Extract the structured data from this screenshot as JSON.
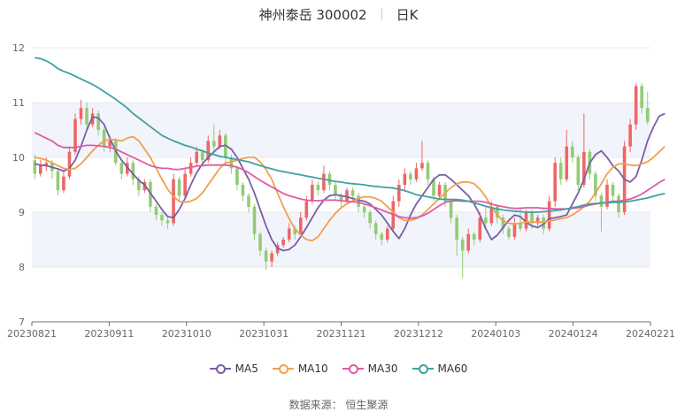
{
  "header": {
    "stock_title": "神州泰岳 300002",
    "period_label": "日K"
  },
  "source": {
    "text": "数据来源： 恒生聚源"
  },
  "colors": {
    "up": "#ee6666",
    "down": "#91cc75",
    "band": "#f2f4fb",
    "grid": "#e8e8e8"
  },
  "chart_data": {
    "type": "candlestick",
    "title": "神州泰岳 300002",
    "subtitle": "日K",
    "ylim": [
      7,
      12
    ],
    "y_ticks": [
      7,
      8,
      9,
      10,
      11,
      12
    ],
    "x_tick_labels": [
      "20230821",
      "20230911",
      "20231010",
      "20231031",
      "20231121",
      "20231212",
      "20240103",
      "20240124",
      "20240221"
    ],
    "legend": [
      "MA5",
      "MA10",
      "MA30",
      "MA60"
    ],
    "legend_position": "bottom",
    "series": [
      {
        "name": "MA5",
        "color": "#7b5ea7",
        "values": [
          9.88,
          9.86,
          9.85,
          9.82,
          9.79,
          9.75,
          9.8,
          9.95,
          10.2,
          10.5,
          10.74,
          10.72,
          10.6,
          10.35,
          10.12,
          9.95,
          9.82,
          9.7,
          9.58,
          9.5,
          9.35,
          9.2,
          9.05,
          8.92,
          8.9,
          9.05,
          9.25,
          9.5,
          9.72,
          9.88,
          10.0,
          10.1,
          10.2,
          10.22,
          10.15,
          10.0,
          9.8,
          9.6,
          9.35,
          9.05,
          8.75,
          8.5,
          8.34,
          8.3,
          8.32,
          8.4,
          8.55,
          8.72,
          8.9,
          9.08,
          9.22,
          9.3,
          9.32,
          9.3,
          9.28,
          9.25,
          9.22,
          9.2,
          9.15,
          9.05,
          8.95,
          8.8,
          8.65,
          8.52,
          8.7,
          8.95,
          9.15,
          9.3,
          9.45,
          9.6,
          9.68,
          9.68,
          9.6,
          9.5,
          9.4,
          9.3,
          9.15,
          8.95,
          8.7,
          8.5,
          8.58,
          8.72,
          8.85,
          8.95,
          8.92,
          8.82,
          8.75,
          8.72,
          8.78,
          8.88,
          8.9,
          8.92,
          8.95,
          9.15,
          9.35,
          9.6,
          9.9,
          10.05,
          10.12,
          10.0,
          9.85,
          9.75,
          9.6,
          9.55,
          9.65,
          9.95,
          10.3,
          10.55,
          10.75,
          10.8
        ]
      },
      {
        "name": "MA10",
        "color": "#f0a04b",
        "values": [
          10.0,
          9.98,
          9.95,
          9.9,
          9.85,
          9.8,
          9.78,
          9.8,
          9.88,
          10.0,
          10.12,
          10.22,
          10.3,
          10.33,
          10.32,
          10.3,
          10.35,
          10.38,
          10.3,
          10.15,
          10.0,
          9.8,
          9.6,
          9.42,
          9.28,
          9.2,
          9.18,
          9.2,
          9.25,
          9.35,
          9.5,
          9.65,
          9.8,
          9.9,
          9.92,
          9.95,
          9.98,
          10.0,
          10.0,
          9.92,
          9.78,
          9.6,
          9.35,
          9.1,
          8.88,
          8.7,
          8.58,
          8.5,
          8.48,
          8.55,
          8.7,
          8.85,
          8.98,
          9.08,
          9.15,
          9.2,
          9.25,
          9.28,
          9.28,
          9.25,
          9.2,
          9.1,
          9.0,
          8.9,
          8.85,
          8.85,
          8.88,
          8.95,
          9.05,
          9.15,
          9.25,
          9.35,
          9.45,
          9.52,
          9.55,
          9.55,
          9.52,
          9.42,
          9.28,
          9.1,
          8.95,
          8.85,
          8.8,
          8.78,
          8.8,
          8.82,
          8.82,
          8.82,
          8.82,
          8.84,
          8.86,
          8.88,
          8.9,
          8.95,
          9.02,
          9.1,
          9.2,
          9.35,
          9.52,
          9.7,
          9.82,
          9.88,
          9.88,
          9.86,
          9.85,
          9.88,
          9.92,
          10.0,
          10.1,
          10.2
        ]
      },
      {
        "name": "MA30",
        "color": "#e05aa6",
        "values": [
          10.45,
          10.4,
          10.35,
          10.3,
          10.22,
          10.18,
          10.18,
          10.18,
          10.2,
          10.22,
          10.22,
          10.21,
          10.2,
          10.18,
          10.15,
          10.1,
          10.05,
          10.0,
          9.95,
          9.9,
          9.85,
          9.82,
          9.8,
          9.8,
          9.78,
          9.78,
          9.8,
          9.82,
          9.84,
          9.85,
          9.86,
          9.86,
          9.86,
          9.86,
          9.85,
          9.82,
          9.78,
          9.72,
          9.65,
          9.58,
          9.52,
          9.46,
          9.4,
          9.34,
          9.3,
          9.27,
          9.24,
          9.22,
          9.21,
          9.21,
          9.22,
          9.22,
          9.22,
          9.21,
          9.2,
          9.19,
          9.18,
          9.15,
          9.12,
          9.08,
          9.04,
          9.0,
          8.96,
          8.92,
          8.9,
          8.89,
          8.9,
          8.93,
          8.98,
          9.05,
          9.12,
          9.18,
          9.2,
          9.21,
          9.2,
          9.2,
          9.2,
          9.2,
          9.18,
          9.15,
          9.12,
          9.1,
          9.08,
          9.07,
          9.07,
          9.08,
          9.08,
          9.08,
          9.07,
          9.07,
          9.06,
          9.06,
          9.06,
          9.07,
          9.08,
          9.1,
          9.13,
          9.15,
          9.17,
          9.18,
          9.2,
          9.2,
          9.22,
          9.24,
          9.28,
          9.33,
          9.4,
          9.47,
          9.54,
          9.6
        ]
      },
      {
        "name": "MA60",
        "color": "#3fa1a1",
        "values": [
          11.82,
          11.8,
          11.76,
          11.7,
          11.62,
          11.57,
          11.53,
          11.48,
          11.43,
          11.38,
          11.33,
          11.27,
          11.2,
          11.13,
          11.06,
          10.98,
          10.9,
          10.8,
          10.72,
          10.64,
          10.56,
          10.48,
          10.4,
          10.35,
          10.3,
          10.26,
          10.22,
          10.19,
          10.15,
          10.12,
          10.08,
          10.05,
          10.02,
          10.0,
          9.98,
          9.96,
          9.94,
          9.92,
          9.88,
          9.85,
          9.82,
          9.79,
          9.76,
          9.74,
          9.72,
          9.7,
          9.68,
          9.66,
          9.64,
          9.62,
          9.6,
          9.58,
          9.56,
          9.55,
          9.53,
          9.52,
          9.51,
          9.5,
          9.48,
          9.47,
          9.46,
          9.45,
          9.44,
          9.42,
          9.39,
          9.36,
          9.32,
          9.3,
          9.28,
          9.26,
          9.24,
          9.23,
          9.23,
          9.23,
          9.22,
          9.2,
          9.17,
          9.14,
          9.11,
          9.08,
          9.06,
          9.04,
          9.03,
          9.02,
          9.01,
          9.0,
          9.0,
          9.0,
          9.01,
          9.02,
          9.03,
          9.04,
          9.06,
          9.08,
          9.1,
          9.13,
          9.15,
          9.16,
          9.17,
          9.17,
          9.18,
          9.18,
          9.19,
          9.2,
          9.22,
          9.24,
          9.26,
          9.29,
          9.32,
          9.34
        ]
      }
    ],
    "candles": [
      [
        9.95,
        9.7,
        10.05,
        9.6
      ],
      [
        9.7,
        9.85,
        9.95,
        9.65
      ],
      [
        9.85,
        9.9,
        10.0,
        9.75
      ],
      [
        9.9,
        9.75,
        9.95,
        9.6
      ],
      [
        9.75,
        9.4,
        9.8,
        9.3
      ],
      [
        9.4,
        9.65,
        9.75,
        9.35
      ],
      [
        9.65,
        10.1,
        10.2,
        9.6
      ],
      [
        10.1,
        10.7,
        10.8,
        10.05
      ],
      [
        10.7,
        10.9,
        11.05,
        10.6
      ],
      [
        10.9,
        10.6,
        11.0,
        10.5
      ],
      [
        10.6,
        10.8,
        10.9,
        10.55
      ],
      [
        10.8,
        10.5,
        10.85,
        10.4
      ],
      [
        10.5,
        10.2,
        10.55,
        10.1
      ],
      [
        10.2,
        10.3,
        10.4,
        10.1
      ],
      [
        10.3,
        9.9,
        10.35,
        9.85
      ],
      [
        9.9,
        9.7,
        9.95,
        9.6
      ],
      [
        9.7,
        9.9,
        10.0,
        9.65
      ],
      [
        9.9,
        9.6,
        9.95,
        9.5
      ],
      [
        9.6,
        9.4,
        9.65,
        9.3
      ],
      [
        9.4,
        9.55,
        9.6,
        9.35
      ],
      [
        9.55,
        9.1,
        9.6,
        9.0
      ],
      [
        9.1,
        8.95,
        9.15,
        8.85
      ],
      [
        8.95,
        8.85,
        9.0,
        8.75
      ],
      [
        8.85,
        8.8,
        8.9,
        8.7
      ],
      [
        8.8,
        9.6,
        9.7,
        8.75
      ],
      [
        9.6,
        9.3,
        9.65,
        9.2
      ],
      [
        9.3,
        9.7,
        9.8,
        9.25
      ],
      [
        9.7,
        9.9,
        10.0,
        9.65
      ],
      [
        9.9,
        10.1,
        10.2,
        9.85
      ],
      [
        10.1,
        9.95,
        10.15,
        9.85
      ],
      [
        9.95,
        10.3,
        10.4,
        9.9
      ],
      [
        10.3,
        10.2,
        10.6,
        10.1
      ],
      [
        10.2,
        10.4,
        10.5,
        10.15
      ],
      [
        10.4,
        10.0,
        10.45,
        9.9
      ],
      [
        10.0,
        9.8,
        10.05,
        9.7
      ],
      [
        9.8,
        9.5,
        9.85,
        9.4
      ],
      [
        9.5,
        9.3,
        9.55,
        9.2
      ],
      [
        9.3,
        9.1,
        9.35,
        9.0
      ],
      [
        9.1,
        8.6,
        9.15,
        8.5
      ],
      [
        8.6,
        8.3,
        8.65,
        8.2
      ],
      [
        8.3,
        8.1,
        8.35,
        7.95
      ],
      [
        8.1,
        8.25,
        8.3,
        8.0
      ],
      [
        8.25,
        8.4,
        8.45,
        8.2
      ],
      [
        8.4,
        8.5,
        8.55,
        8.35
      ],
      [
        8.5,
        8.7,
        8.8,
        8.45
      ],
      [
        8.7,
        8.6,
        8.75,
        8.5
      ],
      [
        8.6,
        8.9,
        9.0,
        8.55
      ],
      [
        8.9,
        9.2,
        9.3,
        8.85
      ],
      [
        9.2,
        9.5,
        9.6,
        9.15
      ],
      [
        9.5,
        9.4,
        9.55,
        9.3
      ],
      [
        9.4,
        9.7,
        9.85,
        9.35
      ],
      [
        9.7,
        9.5,
        9.75,
        9.4
      ],
      [
        9.5,
        9.3,
        9.55,
        9.2
      ],
      [
        9.3,
        9.2,
        9.35,
        9.1
      ],
      [
        9.2,
        9.4,
        9.45,
        9.15
      ],
      [
        9.4,
        9.3,
        9.45,
        9.2
      ],
      [
        9.3,
        9.1,
        9.35,
        9.0
      ],
      [
        9.1,
        9.0,
        9.15,
        8.9
      ],
      [
        9.0,
        8.8,
        9.05,
        8.7
      ],
      [
        8.8,
        8.6,
        8.85,
        8.5
      ],
      [
        8.6,
        8.5,
        8.65,
        8.4
      ],
      [
        8.5,
        8.7,
        8.75,
        8.45
      ],
      [
        8.7,
        9.2,
        9.3,
        8.65
      ],
      [
        9.2,
        9.5,
        9.6,
        9.1
      ],
      [
        9.5,
        9.7,
        9.8,
        9.4
      ],
      [
        9.7,
        9.6,
        9.75,
        9.5
      ],
      [
        9.6,
        9.8,
        9.9,
        9.55
      ],
      [
        9.8,
        9.9,
        10.3,
        9.75
      ],
      [
        9.9,
        9.6,
        9.95,
        9.5
      ],
      [
        9.6,
        9.3,
        9.65,
        9.2
      ],
      [
        9.3,
        9.5,
        9.55,
        9.25
      ],
      [
        9.5,
        9.2,
        9.55,
        9.1
      ],
      [
        9.2,
        8.9,
        9.25,
        8.8
      ],
      [
        8.9,
        8.5,
        8.95,
        8.2
      ],
      [
        8.5,
        8.3,
        8.55,
        7.8
      ],
      [
        8.3,
        8.6,
        8.7,
        8.25
      ],
      [
        8.6,
        8.5,
        8.65,
        8.4
      ],
      [
        8.5,
        8.9,
        9.0,
        8.45
      ],
      [
        8.9,
        8.8,
        9.1,
        8.7
      ],
      [
        8.8,
        9.1,
        9.2,
        8.75
      ],
      [
        9.1,
        8.9,
        9.15,
        8.8
      ],
      [
        8.9,
        8.7,
        8.95,
        8.6
      ],
      [
        8.7,
        8.55,
        8.75,
        8.5
      ],
      [
        8.55,
        8.8,
        8.9,
        8.5
      ],
      [
        8.8,
        8.7,
        9.1,
        8.65
      ],
      [
        8.7,
        9.0,
        9.05,
        8.65
      ],
      [
        9.0,
        8.8,
        9.05,
        8.7
      ],
      [
        8.8,
        8.9,
        8.95,
        8.75
      ],
      [
        8.9,
        8.7,
        8.95,
        8.6
      ],
      [
        8.7,
        9.2,
        9.3,
        8.65
      ],
      [
        9.2,
        9.9,
        10.0,
        9.1
      ],
      [
        9.9,
        9.6,
        10.0,
        9.5
      ],
      [
        9.6,
        10.2,
        10.5,
        9.55
      ],
      [
        10.2,
        10.0,
        10.3,
        9.9
      ],
      [
        10.0,
        9.5,
        10.05,
        9.4
      ],
      [
        9.5,
        10.1,
        10.8,
        9.45
      ],
      [
        10.1,
        9.7,
        10.15,
        9.6
      ],
      [
        9.7,
        9.3,
        9.75,
        9.2
      ],
      [
        9.3,
        9.1,
        9.35,
        8.65
      ],
      [
        9.1,
        9.5,
        9.6,
        9.05
      ],
      [
        9.5,
        9.3,
        9.55,
        9.2
      ],
      [
        9.3,
        9.0,
        9.35,
        8.9
      ],
      [
        9.0,
        10.2,
        10.3,
        8.95
      ],
      [
        10.2,
        10.6,
        10.7,
        10.1
      ],
      [
        10.6,
        11.3,
        11.35,
        10.5
      ],
      [
        11.3,
        10.9,
        11.35,
        10.8
      ],
      [
        10.9,
        10.65,
        11.2,
        10.6
      ]
    ]
  }
}
